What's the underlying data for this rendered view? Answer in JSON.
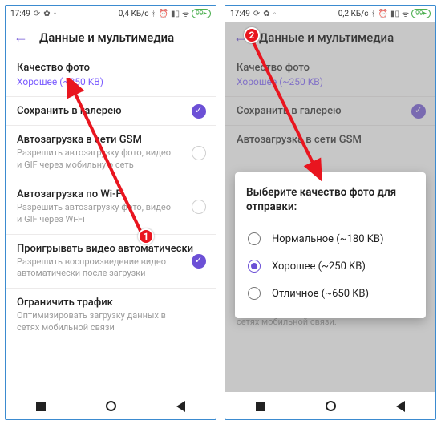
{
  "status": {
    "time": "17:49",
    "data1": "0,4 КБ/с",
    "data2": "0,2 КБ/с",
    "battery": "99"
  },
  "nav": {
    "back_icon": "←"
  },
  "screen1": {
    "title": "Данные и мультимедиа",
    "rows": {
      "photo_quality": {
        "label": "Качество фото",
        "value": "Хорошее (~250 KB)"
      },
      "save_gallery": {
        "label": "Сохранить в галерею"
      },
      "auto_gsm": {
        "label": "Автозагрузка в сети GSM",
        "sub": "Разрешить автозагрузку фото, видео и GIF через мобильную сеть"
      },
      "auto_wifi": {
        "label": "Автозагрузка по Wi-Fi",
        "sub": "Разрешить автозагрузку фото, видео и GIF через Wi-Fi"
      },
      "autoplay": {
        "label": "Проигрывать видео автоматически",
        "sub": "Разрешить воспроизведение видео автоматически после загрузки"
      },
      "limit": {
        "label": "Ограничить трафик",
        "sub": "Оптимизировать загрузку данных в сетях мобильной связи"
      }
    }
  },
  "screen2": {
    "title": "Данные и мультимедиа",
    "rows": {
      "photo_quality": {
        "label": "Качество фото",
        "value": "Хорошее (~250 KB)"
      },
      "save_gallery": {
        "label": "Сохранить в галерею"
      },
      "auto_gsm": {
        "label": "Автозагрузка в сети GSM"
      },
      "limit_sub": "Оптимизировать загрузку данных в сетях мобильной связи."
    },
    "dialog": {
      "title": "Выберите качество фото для отправки:",
      "options": [
        {
          "label": "Нормальное (~180 KB)",
          "selected": false
        },
        {
          "label": "Хорошее (~250 KB)",
          "selected": true
        },
        {
          "label": "Отличное (~650 KB)",
          "selected": false
        }
      ]
    }
  },
  "annotations": {
    "badge1": "1",
    "badge2": "2"
  }
}
